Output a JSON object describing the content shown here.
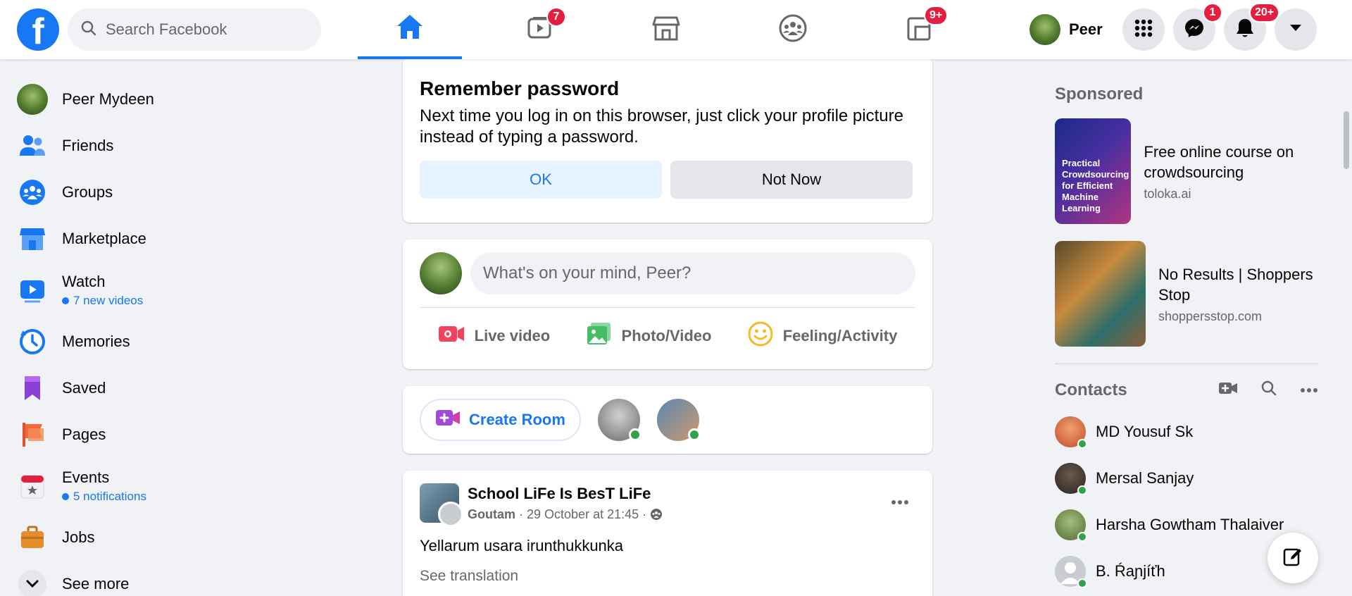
{
  "header": {
    "search_placeholder": "Search Facebook",
    "profile_name": "Peer",
    "badges": {
      "watch": "7",
      "gaming": "9+",
      "messenger": "1",
      "notifications": "20+"
    }
  },
  "sidebar": {
    "items": [
      {
        "label": "Peer Mydeen",
        "icon": "avatar"
      },
      {
        "label": "Friends",
        "icon": "friends-icon"
      },
      {
        "label": "Groups",
        "icon": "groups-icon"
      },
      {
        "label": "Marketplace",
        "icon": "marketplace-icon"
      },
      {
        "label": "Watch",
        "sub": "7 new videos",
        "icon": "watch-icon"
      },
      {
        "label": "Memories",
        "icon": "memories-icon"
      },
      {
        "label": "Saved",
        "icon": "saved-icon"
      },
      {
        "label": "Pages",
        "icon": "pages-icon"
      },
      {
        "label": "Events",
        "sub": "5 notifications",
        "icon": "events-icon"
      },
      {
        "label": "Jobs",
        "icon": "jobs-icon"
      },
      {
        "label": "See more",
        "icon": "chevron-down-icon"
      }
    ]
  },
  "remember": {
    "title": "Remember password",
    "text": "Next time you log in on this browser, just click your profile picture instead of typing a password.",
    "ok": "OK",
    "not_now": "Not Now"
  },
  "composer": {
    "placeholder": "What's on your mind, Peer?",
    "live": "Live video",
    "photo": "Photo/Video",
    "feeling": "Feeling/Activity"
  },
  "rooms": {
    "create": "Create Room"
  },
  "post": {
    "group": "School LiFe Is BesT LiFe",
    "author": "Goutam",
    "time": " · 29 October at 21:45 · ",
    "body": "Yellarum usara irunthukkunka",
    "translate": "See translation"
  },
  "sponsored": {
    "title": "Sponsored",
    "ads": [
      {
        "title": "Free online course on crowdsourcing",
        "domain": "toloka.ai",
        "image_text": "Practical Crowdsourcing for Efficient Machine Learning"
      },
      {
        "title": "No Results | Shoppers Stop",
        "domain": "shoppersstop.com"
      }
    ]
  },
  "contacts": {
    "title": "Contacts",
    "list": [
      {
        "name": "MD Yousuf Sk",
        "color": "#e0704a"
      },
      {
        "name": "Mersal Sanjay",
        "color": "#3b3330"
      },
      {
        "name": "Harsha Gowtham Thalaiver",
        "color": "#6f8a4c"
      },
      {
        "name": "B. Ŕaɲjíťh",
        "color": "#c9ccd1"
      }
    ]
  },
  "colors": {
    "accent": "#1877f2",
    "badge": "#e41e3f",
    "online": "#31a24c"
  }
}
